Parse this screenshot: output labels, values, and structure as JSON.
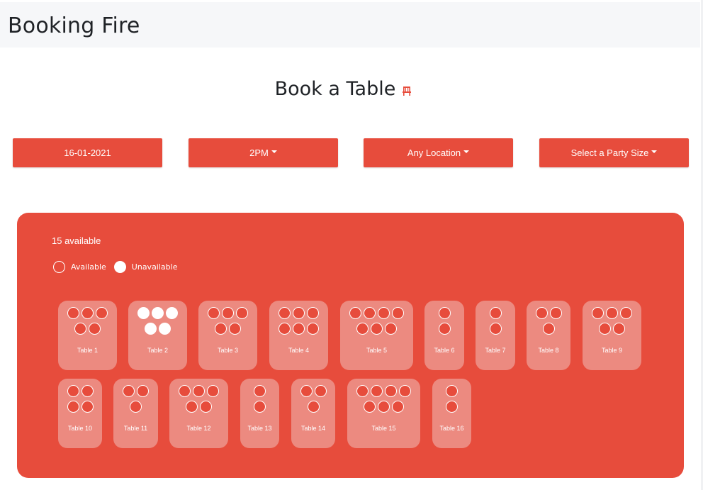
{
  "navbar": {
    "brand": "Booking Fire"
  },
  "page": {
    "title": "Book a Table"
  },
  "filters": {
    "date": "16-01-2021",
    "time": "2PM",
    "location": "Any Location",
    "party_size": "Select a Party Size"
  },
  "panel": {
    "available_text": "15 available",
    "legend": {
      "available": "Available",
      "unavailable": "Unavailable"
    }
  },
  "colors": {
    "accent": "#e74c3c",
    "card": "#ec8a80",
    "navbar": "#f6f7f9"
  },
  "tables": [
    {
      "label": "Table 1",
      "rows": [
        3,
        2
      ],
      "available": true
    },
    {
      "label": "Table 2",
      "rows": [
        3,
        2
      ],
      "available": false
    },
    {
      "label": "Table 3",
      "rows": [
        3,
        2
      ],
      "available": true
    },
    {
      "label": "Table 4",
      "rows": [
        3,
        3
      ],
      "available": true
    },
    {
      "label": "Table 5",
      "rows": [
        4,
        3
      ],
      "available": true
    },
    {
      "label": "Table 6",
      "rows": [
        1,
        1
      ],
      "available": true
    },
    {
      "label": "Table 7",
      "rows": [
        1,
        1
      ],
      "available": true
    },
    {
      "label": "Table 8",
      "rows": [
        2,
        1
      ],
      "available": true
    },
    {
      "label": "Table 9",
      "rows": [
        3,
        2
      ],
      "available": true
    },
    {
      "label": "Table 10",
      "rows": [
        2,
        2
      ],
      "available": true
    },
    {
      "label": "Table 11",
      "rows": [
        2,
        1
      ],
      "available": true
    },
    {
      "label": "Table 12",
      "rows": [
        3,
        2
      ],
      "available": true
    },
    {
      "label": "Table 13",
      "rows": [
        1,
        1
      ],
      "available": true
    },
    {
      "label": "Table 14",
      "rows": [
        2,
        1
      ],
      "available": true
    },
    {
      "label": "Table 15",
      "rows": [
        4,
        3
      ],
      "available": true
    },
    {
      "label": "Table 16",
      "rows": [
        1,
        1
      ],
      "available": true
    }
  ]
}
